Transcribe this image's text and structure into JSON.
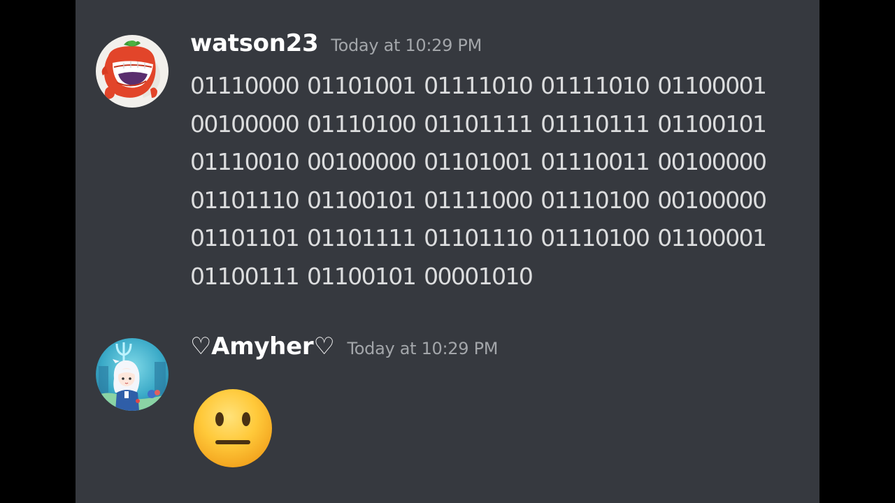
{
  "messages": [
    {
      "username": "watson23",
      "timestamp": "Today at 10:29 PM",
      "avatar_icon": "tomato-face-avatar",
      "content_lines": [
        "01110000 01101001 01111010 01111010 01100001",
        "00100000 01110100 01101111 01110111 01100101",
        "01110010 00100000 01101001 01110011 00100000",
        "01101110 01100101 01111000 01110100 00100000",
        "01101101 01101111 01101110 01110100 01100001",
        "01100111 01100101 00001010"
      ]
    },
    {
      "username": "♡Amyher♡",
      "timestamp": "Today at 10:29 PM",
      "avatar_icon": "shark-girl-avatar",
      "emoji_icon": "neutral-face-emoji"
    }
  ],
  "colors": {
    "background": "#36393f",
    "letterbox": "#000000",
    "username": "#ffffff",
    "timestamp": "#a3a6aa",
    "message_text": "#dcddde"
  }
}
